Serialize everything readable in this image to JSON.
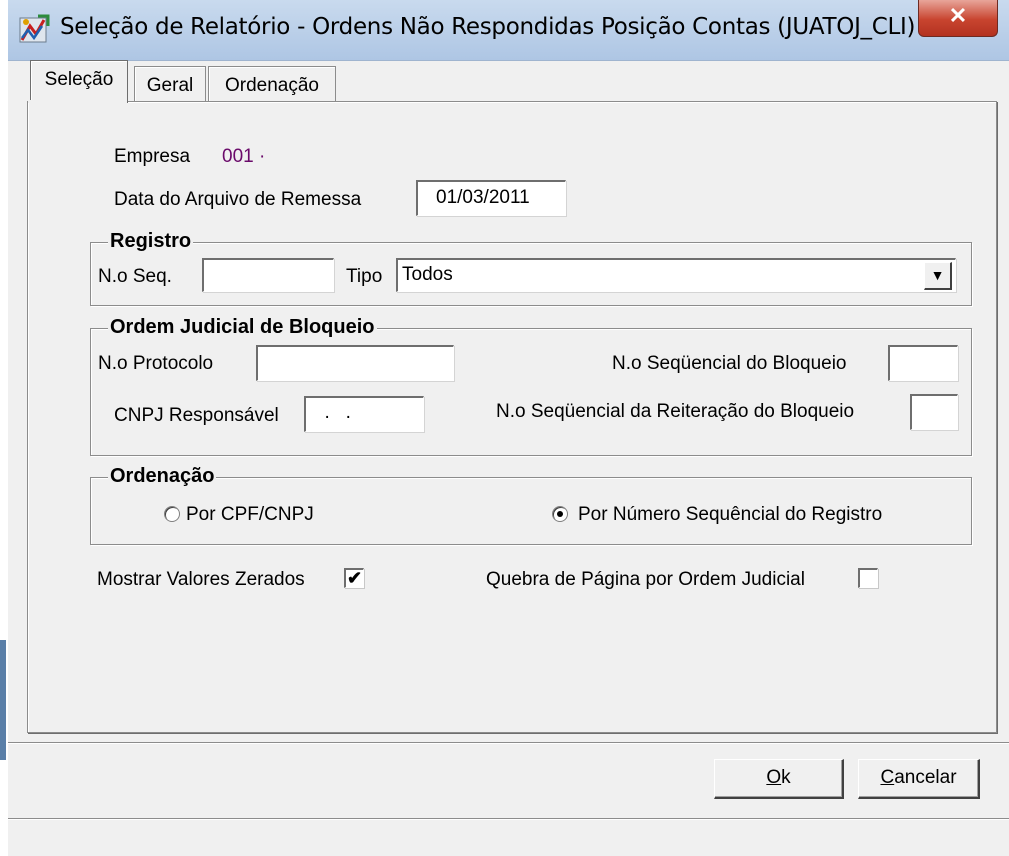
{
  "window": {
    "title": "Seleção de Relatório - Ordens Não Respondidas Posição Contas (JUATOJ_CLI)",
    "close_glyph": "✕"
  },
  "tabs": [
    {
      "label": "Seleção",
      "active": true
    },
    {
      "label": "Geral",
      "active": false
    },
    {
      "label": "Ordenação",
      "active": false
    }
  ],
  "empresa": {
    "label": "Empresa",
    "value": "001 ·",
    "value_color": "#6a0a6a"
  },
  "remessa": {
    "label": "Data do Arquivo de Remessa",
    "value": "01/03/2011"
  },
  "registro": {
    "legend": "Registro",
    "seq_label": "N.o Seq.",
    "seq_value": "",
    "tipo_label": "Tipo",
    "tipo_value": "Todos",
    "dropdown_glyph": "▼"
  },
  "ordem_judicial": {
    "legend": "Ordem Judicial de Bloqueio",
    "protocolo_label": "N.o Protocolo",
    "protocolo_value": "",
    "seq_bloqueio_label": "N.o Seqüencial do Bloqueio",
    "seq_bloqueio_value": "",
    "cnpj_label": "CNPJ Responsável",
    "cnpj_value": "  .   .",
    "seq_reiteracao_label": "N.o Seqüencial da Reiteração do Bloqueio",
    "seq_reiteracao_value": ""
  },
  "ordenacao": {
    "legend": "Ordenação",
    "option_cpf": {
      "label": "Por CPF/CNPJ",
      "selected": false
    },
    "option_seq": {
      "label": "Por Número Sequêncial do Registro",
      "selected": true
    }
  },
  "options": {
    "zerados": {
      "label": "Mostrar Valores Zerados",
      "checked": true,
      "check_glyph": "✔"
    },
    "quebra": {
      "label": "Quebra de Página por Ordem Judicial",
      "checked": false
    }
  },
  "buttons": {
    "ok": "Ok",
    "cancel": "Cancelar"
  }
}
